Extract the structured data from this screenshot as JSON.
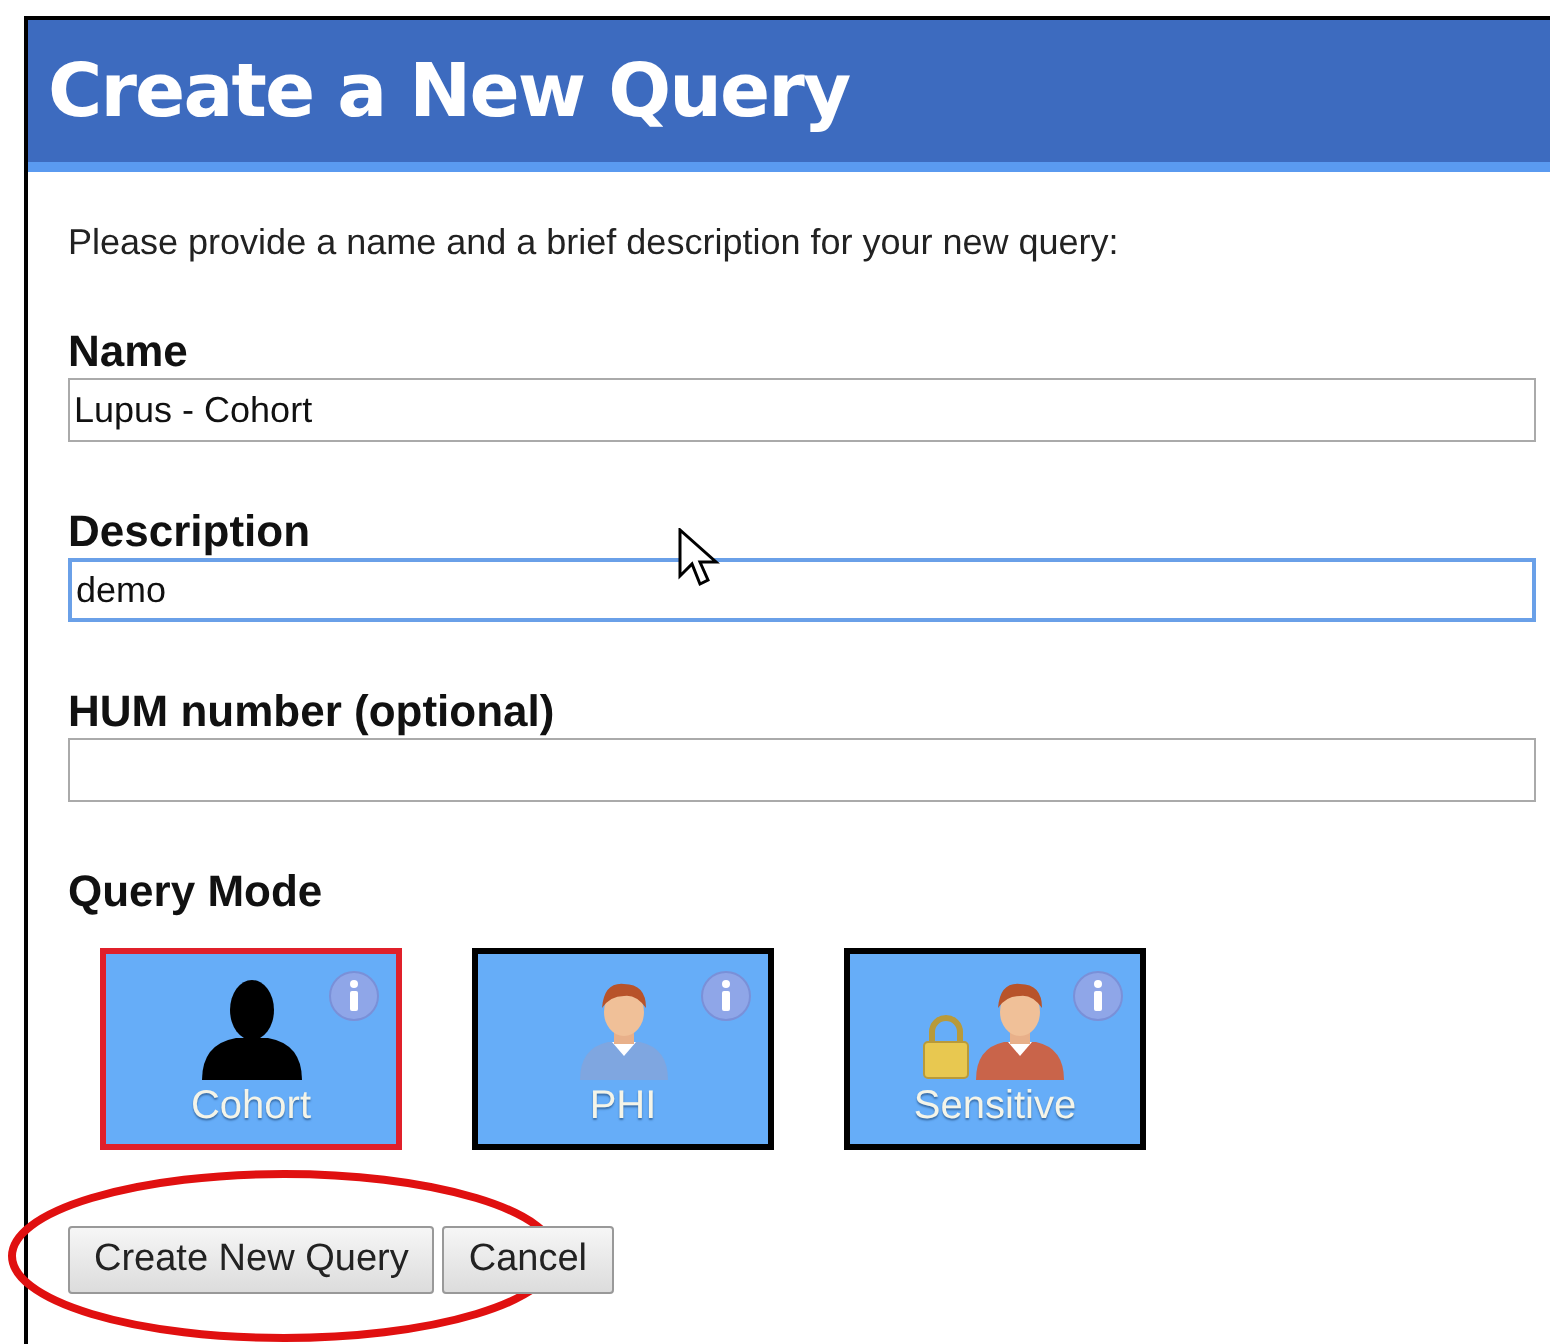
{
  "dialog": {
    "title": "Create a New Query",
    "intro": "Please provide a name and a brief description for your new query:"
  },
  "fields": [
    {
      "label": "Name",
      "value": "Lupus - Cohort",
      "focused": false
    },
    {
      "label": "Description",
      "value": "demo",
      "focused": true
    },
    {
      "label": "HUM number (optional)",
      "focused": false
    }
  ],
  "query_mode": {
    "label": "Query Mode",
    "modes": [
      {
        "label": "Cohort",
        "kind": "silhouette",
        "selected": true
      },
      {
        "label": "PHI",
        "kind": "person",
        "selected": false
      },
      {
        "label": "Sensitive",
        "kind": "locked",
        "selected": false
      }
    ]
  },
  "buttons": [
    {
      "label": "Create New Query",
      "highlighted": true
    },
    {
      "label": "Cancel",
      "highlighted": false
    }
  ]
}
